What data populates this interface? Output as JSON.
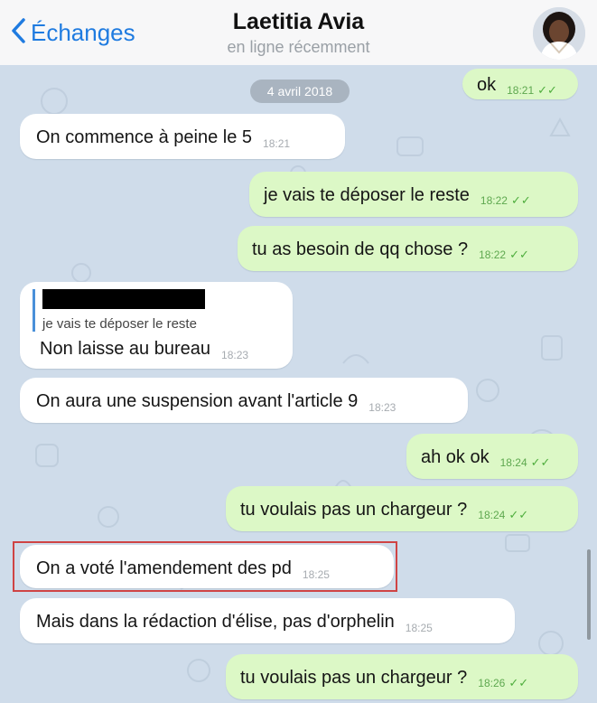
{
  "header": {
    "back_label": "Échanges",
    "contact_name": "Laetitia Avia",
    "status": "en ligne récemment"
  },
  "chat": {
    "date_separator": "4 avril 2018",
    "messages": [
      {
        "direction": "out",
        "text": "ok",
        "time": "18:21",
        "read": true
      },
      {
        "direction": "in",
        "text": "On commence à peine le 5",
        "time": "18:21"
      },
      {
        "direction": "out",
        "text": "je vais te déposer le reste",
        "time": "18:22",
        "read": true
      },
      {
        "direction": "out",
        "text": "tu as besoin de qq chose ?",
        "time": "18:22",
        "read": true
      },
      {
        "direction": "in",
        "text": "Non laisse au bureau",
        "time": "18:23",
        "reply_to": "je vais te déposer le reste",
        "reply_author_redacted": true
      },
      {
        "direction": "in",
        "text": "On aura une suspension avant l'article 9",
        "time": "18:23"
      },
      {
        "direction": "out",
        "text": "ah ok ok",
        "time": "18:24",
        "read": true
      },
      {
        "direction": "out",
        "text": "tu voulais pas un chargeur ?",
        "time": "18:24",
        "read": true
      },
      {
        "direction": "in",
        "text": "On a voté l'amendement des pd",
        "time": "18:25",
        "highlighted": true
      },
      {
        "direction": "in",
        "text": "Mais dans la rédaction d'élise, pas d'orphelin",
        "time": "18:25"
      },
      {
        "direction": "out",
        "text": "tu voulais pas un chargeur ?",
        "time": "18:26",
        "read": true
      }
    ]
  },
  "icons": {
    "back": "chevron-left-icon",
    "read_receipt": "double-check-icon",
    "avatar": "contact-avatar"
  },
  "colors": {
    "accent": "#1f7be0",
    "outgoing_bubble": "#dcf8c6",
    "incoming_bubble": "#ffffff",
    "chat_background": "#cfdcea",
    "highlight_border": "#cf4444",
    "read_tick": "#4fae3e"
  }
}
